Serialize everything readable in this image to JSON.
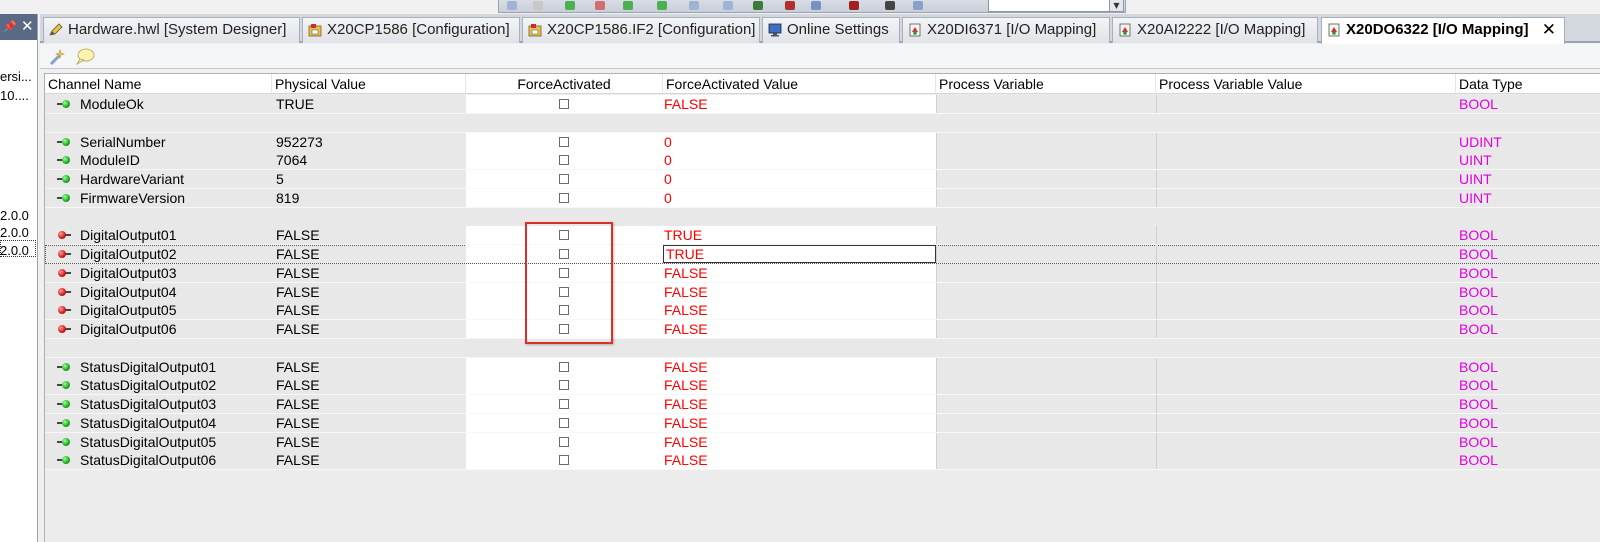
{
  "left_panel": {
    "lines": [
      {
        "text": "ersi..."
      },
      {
        "text": "10...."
      },
      {
        "text": "2.0.0"
      },
      {
        "text": "2.0.0"
      },
      {
        "text": "2.0.0"
      }
    ]
  },
  "tabs": [
    {
      "label": "Hardware.hwl [System Designer]",
      "icon": "pencil-icon",
      "active": false
    },
    {
      "label": "X20CP1586 [Configuration]",
      "icon": "config-icon",
      "active": false
    },
    {
      "label": "X20CP1586.IF2 [Configuration]",
      "icon": "config-icon",
      "active": false
    },
    {
      "label": "Online Settings",
      "icon": "monitor-icon",
      "active": false
    },
    {
      "label": "X20DI6371 [I/O Mapping]",
      "icon": "io-mapping-icon",
      "active": false
    },
    {
      "label": "X20AI2222 [I/O Mapping]",
      "icon": "io-mapping-icon",
      "active": false
    },
    {
      "label": "X20DO6322 [I/O Mapping]",
      "icon": "io-mapping-icon",
      "active": true
    }
  ],
  "tab_close_glyph": "✕",
  "columns": {
    "channel_name": "Channel Name",
    "physical_value": "Physical Value",
    "force_activated": "ForceActivated",
    "force_activated_value": "ForceActivated Value",
    "process_variable": "Process Variable",
    "process_variable_value": "Process Variable Value",
    "data_type": "Data Type"
  },
  "rows": [
    {
      "kind": "data",
      "dir": "in",
      "name": "ModuleOk",
      "physical": "TRUE",
      "force_value": "FALSE",
      "data_type": "BOOL"
    },
    {
      "kind": "blank"
    },
    {
      "kind": "data",
      "dir": "in",
      "name": "SerialNumber",
      "physical": "952273",
      "force_value": "0",
      "data_type": "UDINT"
    },
    {
      "kind": "data",
      "dir": "in",
      "name": "ModuleID",
      "physical": "7064",
      "force_value": "0",
      "data_type": "UINT"
    },
    {
      "kind": "data",
      "dir": "in",
      "name": "HardwareVariant",
      "physical": "5",
      "force_value": "0",
      "data_type": "UINT"
    },
    {
      "kind": "data",
      "dir": "in",
      "name": "FirmwareVersion",
      "physical": "819",
      "force_value": "0",
      "data_type": "UINT"
    },
    {
      "kind": "blank"
    },
    {
      "kind": "data",
      "dir": "out",
      "name": "DigitalOutput01",
      "physical": "FALSE",
      "force_value": "TRUE",
      "data_type": "BOOL"
    },
    {
      "kind": "data",
      "dir": "out",
      "name": "DigitalOutput02",
      "physical": "FALSE",
      "force_value": "TRUE",
      "data_type": "BOOL",
      "editing": true
    },
    {
      "kind": "data",
      "dir": "out",
      "name": "DigitalOutput03",
      "physical": "FALSE",
      "force_value": "FALSE",
      "data_type": "BOOL"
    },
    {
      "kind": "data",
      "dir": "out",
      "name": "DigitalOutput04",
      "physical": "FALSE",
      "force_value": "FALSE",
      "data_type": "BOOL"
    },
    {
      "kind": "data",
      "dir": "out",
      "name": "DigitalOutput05",
      "physical": "FALSE",
      "force_value": "FALSE",
      "data_type": "BOOL"
    },
    {
      "kind": "data",
      "dir": "out",
      "name": "DigitalOutput06",
      "physical": "FALSE",
      "force_value": "FALSE",
      "data_type": "BOOL"
    },
    {
      "kind": "blank"
    },
    {
      "kind": "data",
      "dir": "in",
      "name": "StatusDigitalOutput01",
      "physical": "FALSE",
      "force_value": "FALSE",
      "data_type": "BOOL"
    },
    {
      "kind": "data",
      "dir": "in",
      "name": "StatusDigitalOutput02",
      "physical": "FALSE",
      "force_value": "FALSE",
      "data_type": "BOOL"
    },
    {
      "kind": "data",
      "dir": "in",
      "name": "StatusDigitalOutput03",
      "physical": "FALSE",
      "force_value": "FALSE",
      "data_type": "BOOL"
    },
    {
      "kind": "data",
      "dir": "in",
      "name": "StatusDigitalOutput04",
      "physical": "FALSE",
      "force_value": "FALSE",
      "data_type": "BOOL"
    },
    {
      "kind": "data",
      "dir": "in",
      "name": "StatusDigitalOutput05",
      "physical": "FALSE",
      "force_value": "FALSE",
      "data_type": "BOOL"
    },
    {
      "kind": "data",
      "dir": "in",
      "name": "StatusDigitalOutput06",
      "physical": "FALSE",
      "force_value": "FALSE",
      "data_type": "BOOL"
    }
  ],
  "colors": {
    "force_value_text": "#ff0000",
    "data_type_text": "#e000e0",
    "highlight_border": "#d9302c",
    "input_dot": "#1ea81e",
    "output_dot": "#cc1a1a"
  }
}
